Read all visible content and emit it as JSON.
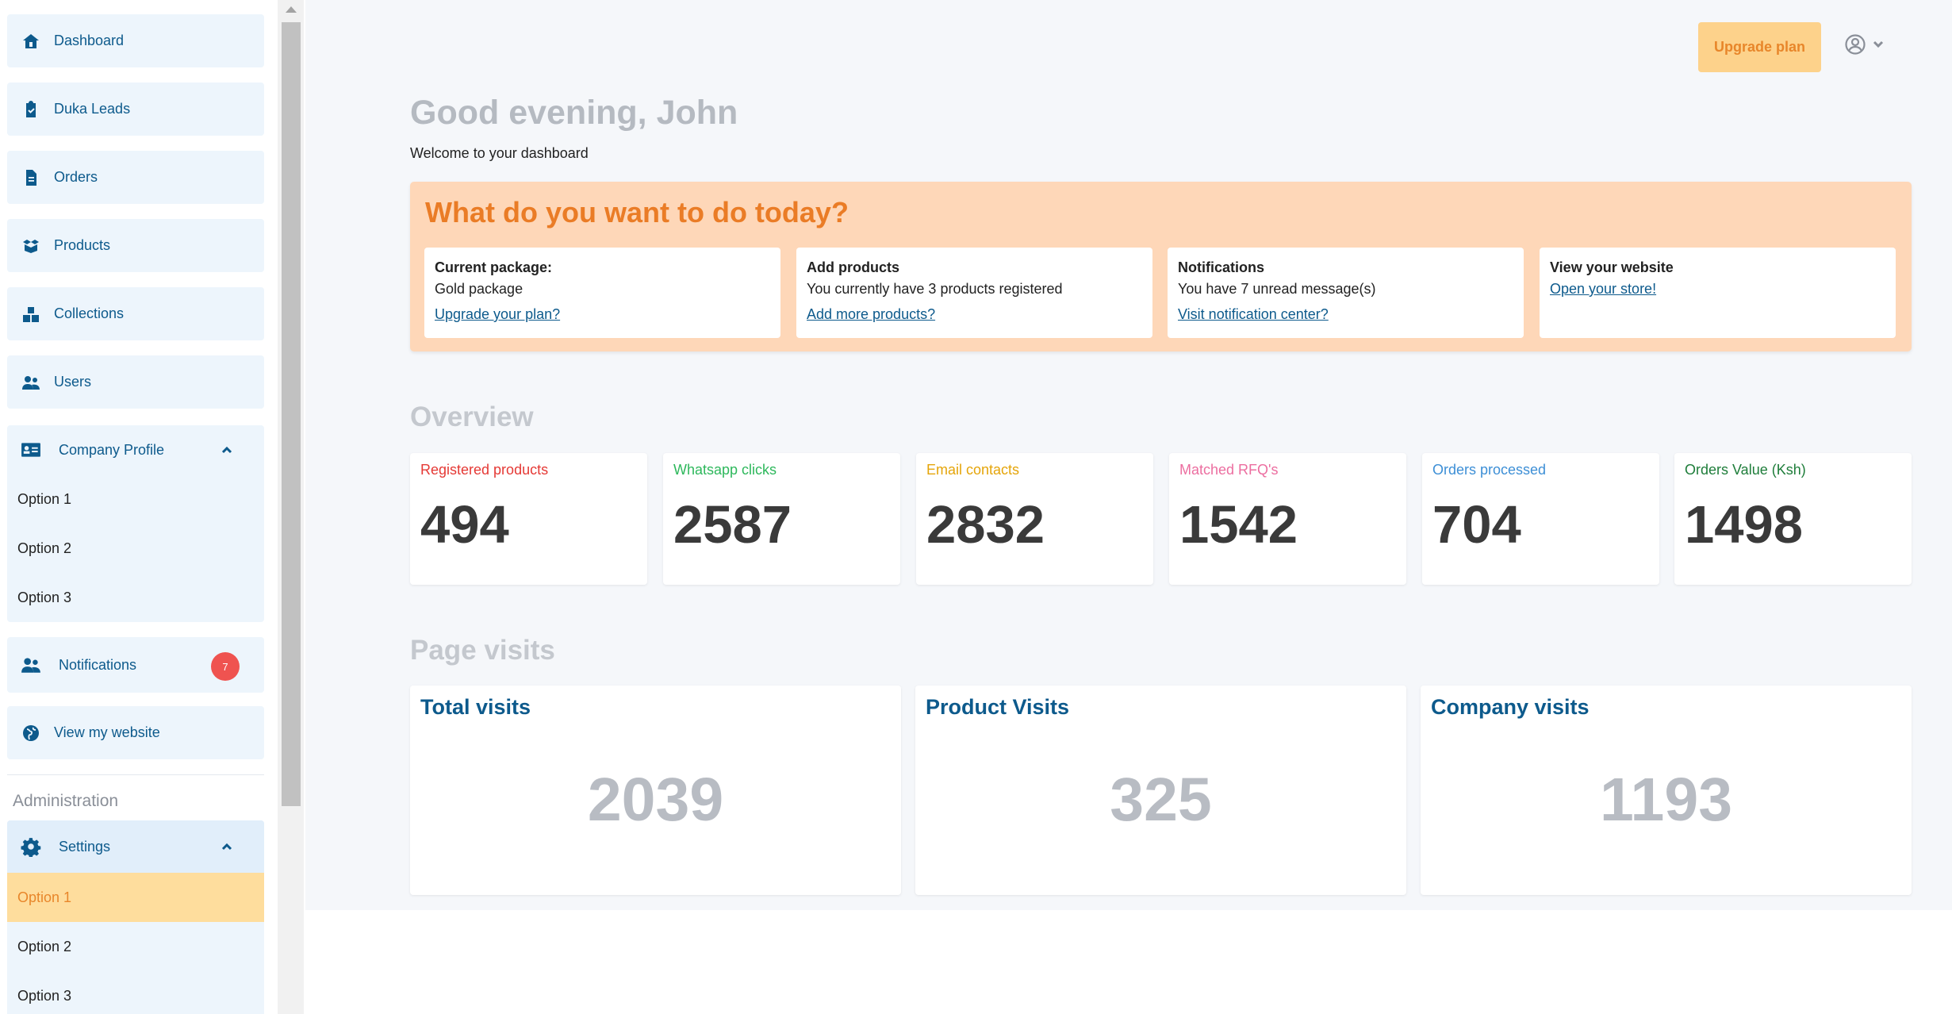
{
  "sidebar": {
    "items": [
      {
        "label": "Dashboard",
        "icon": "home-icon"
      },
      {
        "label": "Duka Leads",
        "icon": "clipboard-check-icon"
      },
      {
        "label": "Orders",
        "icon": "document-icon"
      },
      {
        "label": "Products",
        "icon": "box-icon"
      },
      {
        "label": "Collections",
        "icon": "boxes-icon"
      },
      {
        "label": "Users",
        "icon": "users-icon"
      }
    ],
    "company_profile": {
      "label": "Company Profile",
      "icon": "id-card-icon",
      "options": [
        "Option 1",
        "Option 2",
        "Option 3"
      ]
    },
    "notifications": {
      "label": "Notifications",
      "count": "7"
    },
    "view_website": {
      "label": "View my website"
    },
    "admin_label": "Administration",
    "settings": {
      "label": "Settings",
      "options": [
        "Option 1",
        "Option 2",
        "Option 3"
      ],
      "active_option": "Option 1"
    }
  },
  "header": {
    "upgrade_label": "Upgrade plan"
  },
  "greeting": "Good evening, John",
  "welcome": "Welcome to your dashboard",
  "todo": {
    "title": "What do you want to do today?",
    "cards": [
      {
        "title": "Current package:",
        "text": "Gold package",
        "link": "Upgrade your plan?"
      },
      {
        "title": "Add products",
        "text": "You currently have 3 products registered",
        "link": "Add more products?"
      },
      {
        "title": "Notifications",
        "text": "You have 7 unread message(s)",
        "link": "Visit notification center?"
      },
      {
        "title": "View your website",
        "text": "",
        "link": "Open your store!"
      }
    ]
  },
  "overview": {
    "title": "Overview",
    "stats": [
      {
        "label": "Registered products",
        "value": "494",
        "color": "#e53935"
      },
      {
        "label": "Whatsapp clicks",
        "value": "2587",
        "color": "#2eb85c"
      },
      {
        "label": "Email contacts",
        "value": "2832",
        "color": "#e5a50a"
      },
      {
        "label": "Matched RFQ's",
        "value": "1542",
        "color": "#ec6ea0"
      },
      {
        "label": "Orders processed",
        "value": "704",
        "color": "#3d8fd6"
      },
      {
        "label": "Orders Value (Ksh)",
        "value": "1498",
        "color": "#1e7d3a"
      }
    ]
  },
  "page_visits": {
    "title": "Page visits",
    "cards": [
      {
        "label": "Total visits",
        "value": "2039"
      },
      {
        "label": "Product Visits",
        "value": "325"
      },
      {
        "label": "Company visits",
        "value": "1193"
      }
    ]
  }
}
